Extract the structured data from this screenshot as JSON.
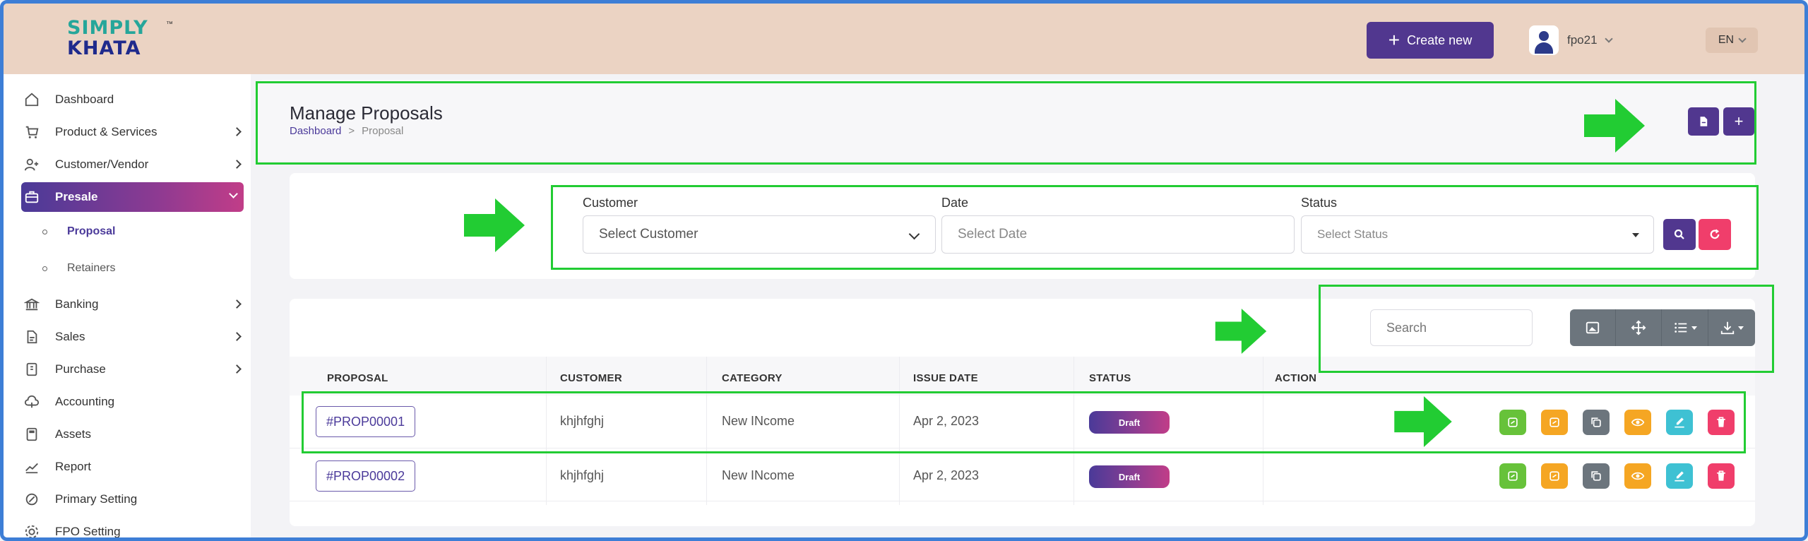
{
  "header": {
    "logo_line1": "SIMPLY",
    "logo_line2": "KHATA",
    "logo_tm": "™",
    "create_label": "Create new",
    "user_name": "fpo21",
    "language": "EN"
  },
  "sidebar": {
    "items": [
      {
        "label": "Dashboard",
        "icon": "home-icon"
      },
      {
        "label": "Product & Services",
        "icon": "cart-icon",
        "has_arrow": true
      },
      {
        "label": "Customer/Vendor",
        "icon": "user-plus-icon",
        "has_arrow": true
      },
      {
        "label": "Presale",
        "icon": "briefcase-icon",
        "active": true
      },
      {
        "label": "Proposal",
        "sub": true,
        "current": true
      },
      {
        "label": "Retainers",
        "sub": true
      },
      {
        "label": "Banking",
        "icon": "bank-icon",
        "has_arrow": true
      },
      {
        "label": "Sales",
        "icon": "file-icon",
        "has_arrow": true
      },
      {
        "label": "Purchase",
        "icon": "wallet-icon",
        "has_arrow": true
      },
      {
        "label": "Accounting",
        "icon": "cloud-icon"
      },
      {
        "label": "Assets",
        "icon": "calculator-icon"
      },
      {
        "label": "Report",
        "icon": "chart-icon"
      },
      {
        "label": "Primary Setting",
        "icon": "settings-icon"
      },
      {
        "label": "FPO Setting",
        "icon": "gear-icon"
      }
    ]
  },
  "page": {
    "title": "Manage Proposals",
    "breadcrumb_home": "Dashboard",
    "breadcrumb_sep": ">",
    "breadcrumb_current": "Proposal"
  },
  "filters": {
    "customer_label": "Customer",
    "customer_value": "Select Customer",
    "date_label": "Date",
    "date_placeholder": "Select Date",
    "status_label": "Status",
    "status_placeholder": "Select Status"
  },
  "table": {
    "search_placeholder": "Search",
    "columns": [
      "PROPOSAL",
      "CUSTOMER",
      "CATEGORY",
      "ISSUE DATE",
      "STATUS",
      "ACTION"
    ],
    "rows": [
      {
        "proposal": "#PROP00001",
        "customer": "khjhfghj",
        "category": "New INcome",
        "issue_date": "Apr 2, 2023",
        "status": "Draft"
      },
      {
        "proposal": "#PROP00002",
        "customer": "khjhfghj",
        "category": "New INcome",
        "issue_date": "Apr 2, 2023",
        "status": "Draft"
      }
    ],
    "actions": [
      {
        "name": "convert-icon",
        "color": "#67c23a"
      },
      {
        "name": "duplicate-icon",
        "color": "#f5a623"
      },
      {
        "name": "copy-icon",
        "color": "#6c757d"
      },
      {
        "name": "eye-icon",
        "color": "#f5a623"
      },
      {
        "name": "edit-icon",
        "color": "#3ec1d3"
      },
      {
        "name": "trash-icon",
        "color": "#f03e6b"
      }
    ]
  },
  "colors": {
    "primary": "#51378f",
    "header_bg": "#ebd3c3",
    "annotation": "#22cc33",
    "danger": "#f03e6b"
  }
}
